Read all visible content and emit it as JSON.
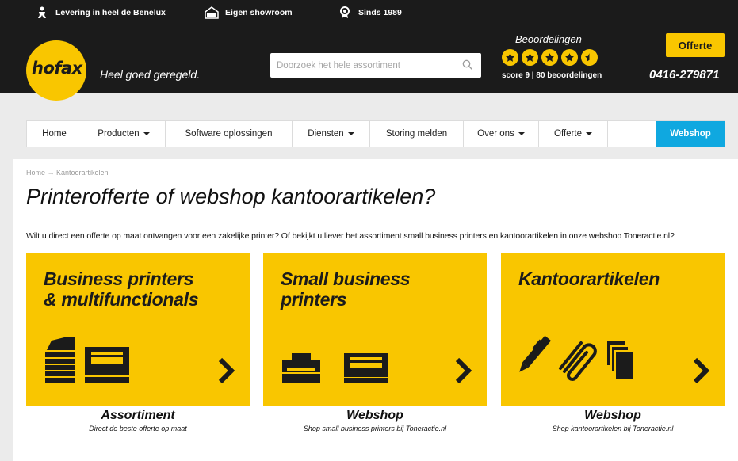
{
  "usps": [
    {
      "icon": "delivery-person-icon",
      "label": "Levering in heel de Benelux"
    },
    {
      "icon": "open-shop-icon",
      "label": "Eigen showroom"
    },
    {
      "icon": "award-badge-icon",
      "label": "Sinds 1989"
    }
  ],
  "brand": {
    "logo_text": "hofax",
    "tagline": "Heel goed geregeld."
  },
  "search": {
    "placeholder": "Doorzoek het hele assortiment"
  },
  "reviews": {
    "title": "Beoordelingen",
    "score_text": "score 9 | 80 beoordelingen",
    "stars": 4.5
  },
  "header": {
    "quote_button": "Offerte",
    "phone": "0416-279871"
  },
  "nav": [
    {
      "label": "Home",
      "dropdown": false
    },
    {
      "label": "Producten",
      "dropdown": true
    },
    {
      "label": "Software oplossingen",
      "dropdown": false
    },
    {
      "label": "Diensten",
      "dropdown": true
    },
    {
      "label": "Storing melden",
      "dropdown": false
    },
    {
      "label": "Over ons",
      "dropdown": true
    },
    {
      "label": "Offerte",
      "dropdown": true
    },
    {
      "label": "Webshop",
      "dropdown": false
    }
  ],
  "breadcrumb": "Home → Kantoorartikelen",
  "page_title": "Printerofferte of webshop kantoorartikelen?",
  "intro": "Wilt u direct een offerte op maat ontvangen voor een zakelijke printer? Of bekijkt u liever het assortiment small business printers en kantoorartikelen in onze webshop Toneractie.nl?",
  "tiles": [
    {
      "title": "Business printers\n& multifunctionals",
      "caption": "Assortiment",
      "subcaption": "Direct de beste offerte op maat"
    },
    {
      "title": "Small business\nprinters",
      "caption": "Webshop",
      "subcaption": "Shop small business printers bij Toneractie.nl"
    },
    {
      "title": "Kantoorartikelen",
      "caption": "Webshop",
      "subcaption": "Shop kantoorartikelen bij Toneractie.nl"
    }
  ],
  "colors": {
    "brand_yellow": "#f9c600",
    "header_black": "#1b1b1b",
    "webshop_blue": "#0fa8e0"
  }
}
